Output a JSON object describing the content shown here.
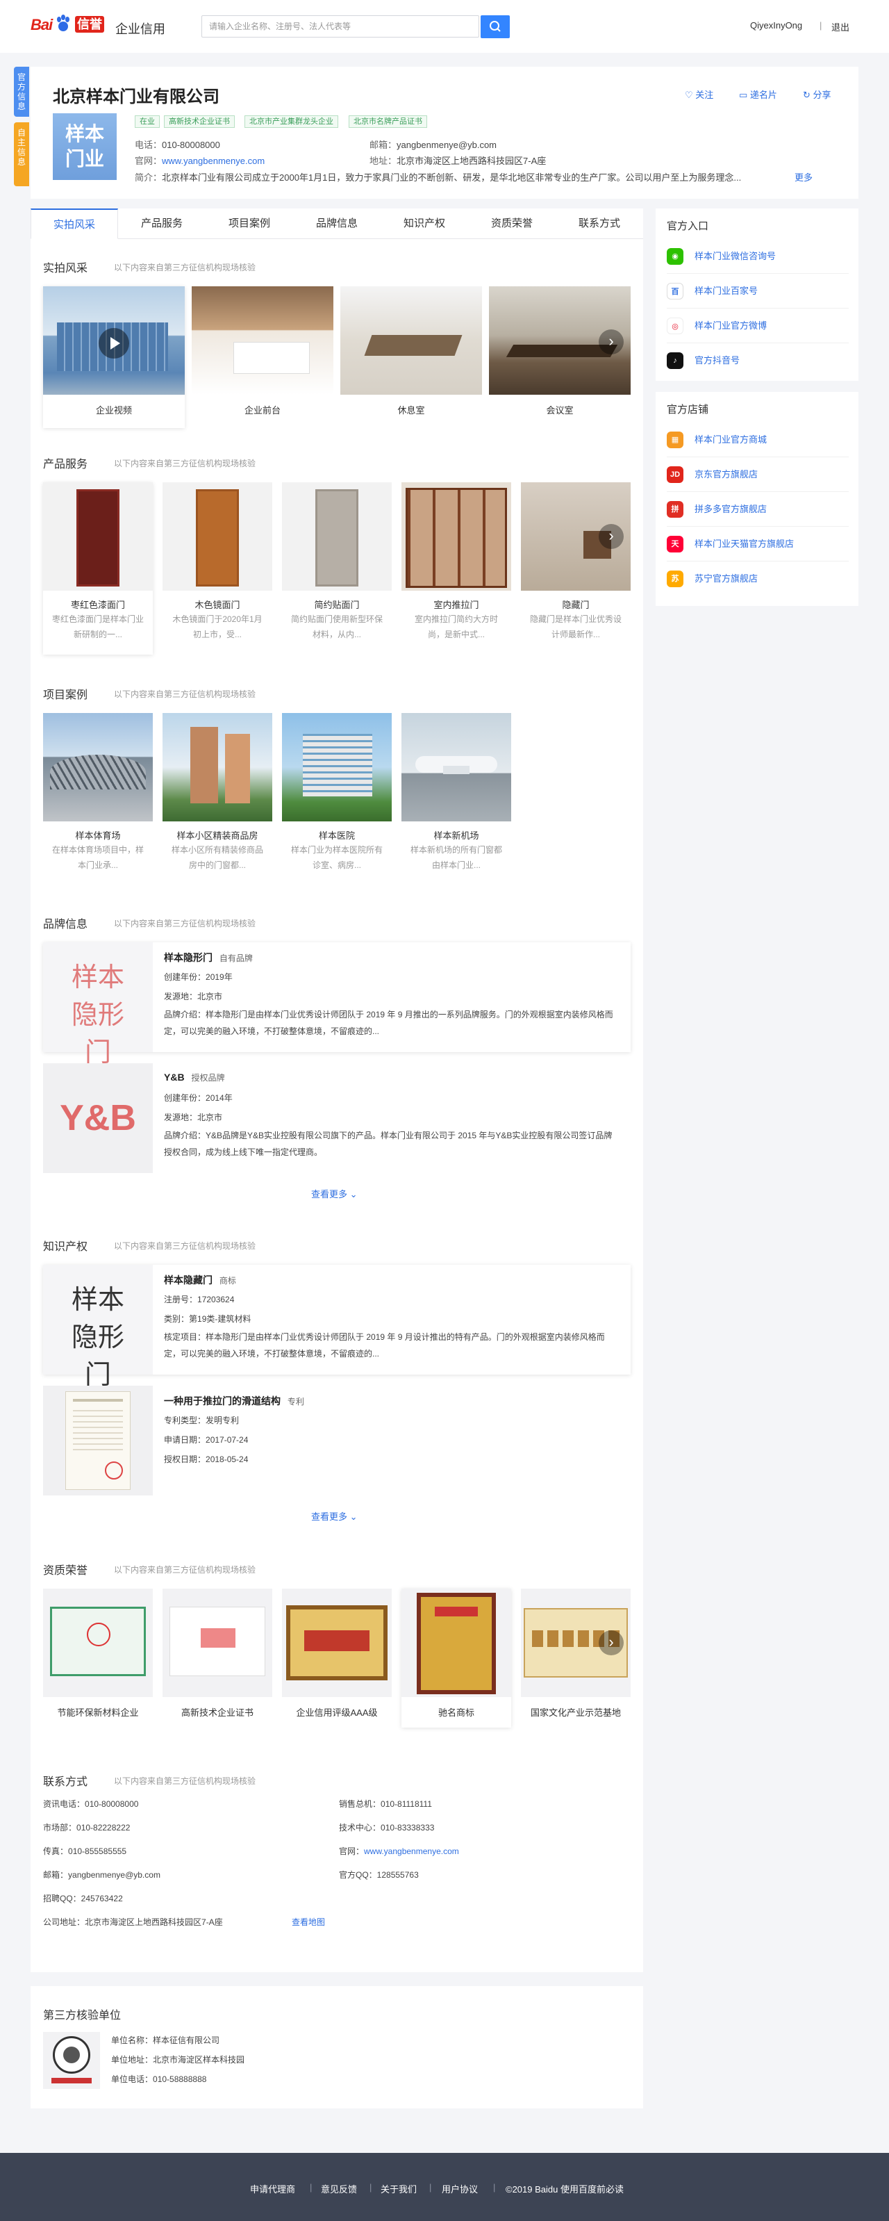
{
  "header": {
    "logo_bai": "Bai",
    "logo_xin": "信誉",
    "brand_sub": "企业信用",
    "search_placeholder": "请输入企业名称、注册号、法人代表等",
    "user_name": "QiyexInyOng",
    "separator": "|",
    "logout": "退出"
  },
  "side_tabs": [
    "官方信息",
    "自主信息"
  ],
  "company": {
    "name": "北京样本门业有限公司",
    "logo_text": "样本门业",
    "tags": [
      "在业",
      "高新技术企业证书",
      "北京市产业集群龙头企业",
      "北京市名牌产品证书"
    ],
    "phone_label": "电话：",
    "phone": "010-80008000",
    "site_label": "官网：",
    "site": "www.yangbenmenye.com",
    "email_label": "邮箱：",
    "email": "yangbenmenye@yb.com",
    "addr_label": "地址：",
    "addr": "北京市海淀区上地西路科技园区7-A座",
    "intro_label": "简介：",
    "intro": "北京样本门业有限公司成立于2000年1月1日，致力于家具门业的不断创新、研发，是华北地区非常专业的生产厂家。公司以用户至上为服务理念...",
    "intro_more": "更多",
    "follow": "关注",
    "vcard": "递名片",
    "share": "分享"
  },
  "tabs": [
    "实拍风采",
    "产品服务",
    "项目案例",
    "品牌信息",
    "知识产权",
    "资质荣誉",
    "联系方式"
  ],
  "source_note": "以下内容来自第三方征信机构现场核验",
  "photos": {
    "title": "实拍风采",
    "items": [
      "企业视频",
      "企业前台",
      "休息室",
      "会议室"
    ]
  },
  "products": {
    "title": "产品服务",
    "items": [
      {
        "name": "枣红色漆面门",
        "desc": "枣红色漆面门是样本门业新研制的一..."
      },
      {
        "name": "木色镜面门",
        "desc": "木色镜面门于2020年1月初上市，受..."
      },
      {
        "name": "简约贴面门",
        "desc": "简约贴面门使用新型环保材料，从内..."
      },
      {
        "name": "室内推拉门",
        "desc": "室内推拉门简约大方时尚，是新中式..."
      },
      {
        "name": "隐藏门",
        "desc": "隐藏门是样本门业优秀设计师最新作..."
      }
    ]
  },
  "cases": {
    "title": "项目案例",
    "items": [
      {
        "name": "样本体育场",
        "desc": "在样本体育场项目中，样本门业承..."
      },
      {
        "name": "样本小区精装商品房",
        "desc": "样本小区所有精装修商品房中的门窗都..."
      },
      {
        "name": "样本医院",
        "desc": "样本门业为样本医院所有诊室、病房..."
      },
      {
        "name": "样本新机场",
        "desc": "样本新机场的所有门窗都由样本门业..."
      }
    ]
  },
  "brands": {
    "title": "品牌信息",
    "items": [
      {
        "logo": "样本 隐形门",
        "name": "样本隐形门",
        "type": "自有品牌",
        "year_label": "创建年份：",
        "year": "2019年",
        "origin_label": "发源地：",
        "origin": "北京市",
        "intro_label": "品牌介绍：",
        "intro": "样本隐形门是由样本门业优秀设计师团队于 2019 年 9 月推出的一系列品牌服务。门的外观根据室内装修风格而定，可以完美的融入环境，不打破整体意境，不留痕迹的..."
      },
      {
        "logo": "Y&B",
        "name": "Y&B",
        "type": "授权品牌",
        "year_label": "创建年份：",
        "year": "2014年",
        "origin_label": "发源地：",
        "origin": "北京市",
        "intro_label": "品牌介绍：",
        "intro": "Y&B品牌是Y&B实业控股有限公司旗下的产品。样本门业有限公司于 2015 年与Y&B实业控股有限公司签订品牌授权合同，成为线上线下唯一指定代理商。"
      }
    ],
    "more": "查看更多"
  },
  "ip": {
    "title": "知识产权",
    "items": [
      {
        "logo": "样本 隐形门",
        "name": "样本隐藏门",
        "type": "商标",
        "l1": "注册号：",
        "v1": "17203624",
        "l2": "类别：",
        "v2": "第19类-建筑材料",
        "l3": "核定项目：",
        "v3": "样本隐形门是由样本门业优秀设计师团队于 2019 年 9 月设计推出的特有产品。门的外观根据室内装修风格而定，可以完美的融入环境，不打破整体意境，不留痕迹的..."
      },
      {
        "name": "一种用于推拉门的滑道结构",
        "type": "专利",
        "l1": "专利类型：",
        "v1": "发明专利",
        "l2": "申请日期：",
        "v2": "2017-07-24",
        "l3": "授权日期：",
        "v3": "2018-05-24"
      }
    ],
    "more": "查看更多"
  },
  "honors": {
    "title": "资质荣誉",
    "items": [
      "节能环保新材料企业",
      "高新技术企业证书",
      "企业信用评级AAA级",
      "驰名商标",
      "国家文化产业示范基地"
    ]
  },
  "contact": {
    "title": "联系方式",
    "left": [
      {
        "k": "资讯电话：",
        "v": "010-80008000"
      },
      {
        "k": "市场部：",
        "v": "010-82228222"
      },
      {
        "k": "传真：",
        "v": "010-855585555"
      },
      {
        "k": "邮箱：",
        "v": "yangbenmenye@yb.com"
      },
      {
        "k": "招聘QQ：",
        "v": "245763422"
      },
      {
        "k": "公司地址：",
        "v": "北京市海淀区上地西路科技园区7-A座"
      }
    ],
    "right": [
      {
        "k": "销售总机：",
        "v": "010-81118111"
      },
      {
        "k": "技术中心：",
        "v": "010-83338333"
      },
      {
        "k": "官网：",
        "v": "www.yangbenmenye.com"
      },
      {
        "k": "官方QQ：",
        "v": "128555763"
      }
    ],
    "map": "查看地图"
  },
  "third_party": {
    "title": "第三方核验单位",
    "name_label": "单位名称：",
    "name": "样本征信有限公司",
    "addr_label": "单位地址：",
    "addr": "北京市海淀区样本科技园",
    "phone_label": "单位电话：",
    "phone": "010-58888888"
  },
  "official_entry": {
    "title": "官方入口",
    "items": [
      "样本门业微信咨询号",
      "样本门业百家号",
      "样本门业官方微博",
      "官方抖音号"
    ]
  },
  "official_stores": {
    "title": "官方店铺",
    "items": [
      "样本门业官方商城",
      "京东官方旗舰店",
      "拼多多官方旗舰店",
      "样本门业天猫官方旗舰店",
      "苏宁官方旗舰店"
    ]
  },
  "footer": {
    "links": [
      "申请代理商",
      "意见反馈",
      "关于我们",
      "用户协议"
    ],
    "copyright": "©2019 Baidu 使用百度前必读"
  },
  "colors": {
    "accent": "#2d6ee0",
    "search": "#3385ff",
    "tag_green": "#3a9e5a",
    "footer": "#3d4454",
    "side_blue": "#4d8ef0",
    "side_orange": "#f5a623"
  }
}
